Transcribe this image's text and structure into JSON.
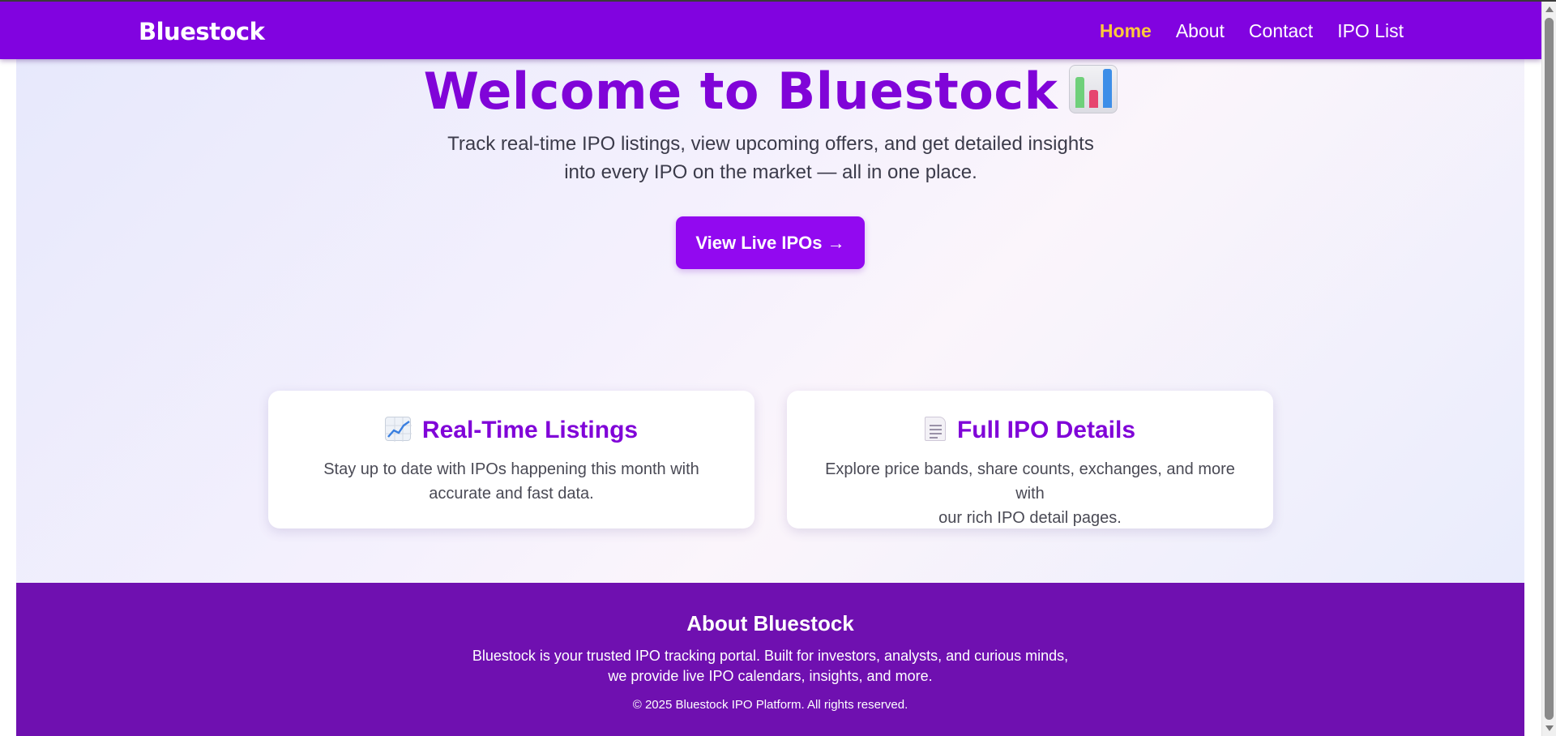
{
  "nav": {
    "brand": "Bluestock",
    "links": [
      {
        "label": "Home",
        "active": true
      },
      {
        "label": "About",
        "active": false
      },
      {
        "label": "Contact",
        "active": false
      },
      {
        "label": "IPO List",
        "active": false
      }
    ]
  },
  "hero": {
    "title": "Welcome to Bluestock",
    "title_icon": "bar-chart-emoji-icon",
    "subtitle_line1": "Track real-time IPO listings, view upcoming offers, and get detailed insights",
    "subtitle_line2": "into every IPO on the market — all in one place.",
    "cta_label": "View Live IPOs →"
  },
  "features": [
    {
      "icon": "chart-increasing-emoji-icon",
      "title": "Real-Time Listings",
      "desc_line1": "Stay up to date with IPOs happening this month with",
      "desc_line2": "accurate and fast data."
    },
    {
      "icon": "page-document-emoji-icon",
      "title": "Full IPO Details",
      "desc_line1": "Explore price bands, share counts, exchanges, and more with",
      "desc_line2": "our rich IPO detail pages."
    }
  ],
  "footer": {
    "title": "About Bluestock",
    "text_line1": "Bluestock is your trusted IPO tracking portal. Built for investors, analysts, and curious minds,",
    "text_line2": "we provide live IPO calendars, insights, and more.",
    "copyright": "© 2025 Bluestock IPO Platform. All rights reserved."
  },
  "colors": {
    "nav_bg": "#8103e0",
    "accent_purple": "#8004d8",
    "active_link": "#ffc93a",
    "cta_bg": "#9209f0",
    "footer_bg": "#6f10b0"
  }
}
